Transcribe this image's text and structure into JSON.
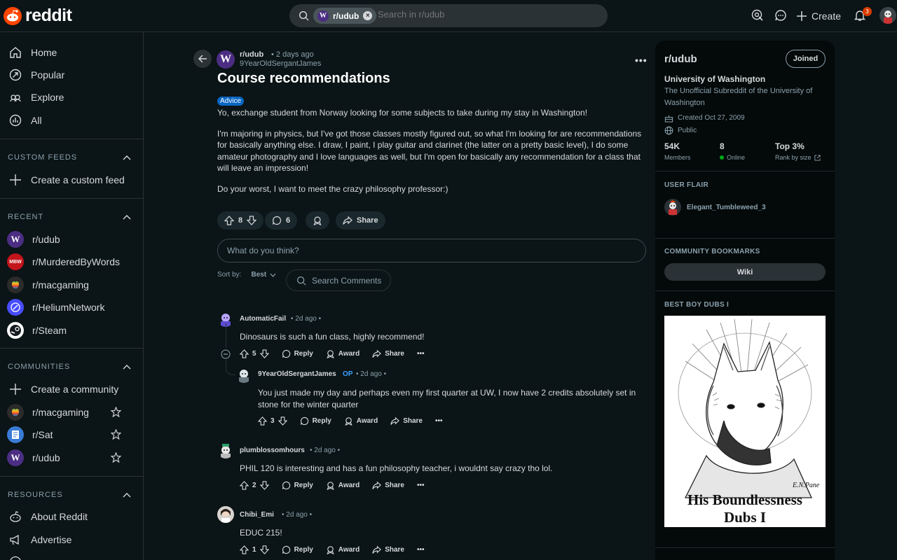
{
  "header": {
    "logo_text": "reddit",
    "search_chip": "r/udub",
    "search_placeholder": "Search in r/udub",
    "create_label": "Create",
    "notification_count": "3"
  },
  "sidebar": {
    "nav": [
      {
        "label": "Home",
        "icon": "home-icon"
      },
      {
        "label": "Popular",
        "icon": "popular-icon"
      },
      {
        "label": "Explore",
        "icon": "explore-icon"
      },
      {
        "label": "All",
        "icon": "all-icon"
      }
    ],
    "custom_feeds_heading": "CUSTOM FEEDS",
    "create_custom_feed": "Create a custom feed",
    "recent_heading": "RECENT",
    "recent": [
      "r/udub",
      "r/MurderedByWords",
      "r/macgaming",
      "r/HeliumNetwork",
      "r/Steam"
    ],
    "communities_heading": "COMMUNITIES",
    "create_community": "Create a community",
    "communities": [
      "r/macgaming",
      "r/Sat",
      "r/udub"
    ],
    "resources_heading": "RESOURCES",
    "resources": [
      "About Reddit",
      "Advertise"
    ]
  },
  "post": {
    "subreddit": "r/udub",
    "time": "• 2 days ago",
    "author": "9YearOldSergantJames",
    "title": "Course recommendations",
    "flair": "Advice",
    "body": [
      "Yo, exchange student from Norway looking for some subjects to take during my stay in Washington!",
      "I'm majoring in physics, but I've got those classes mostly figured out, so what I'm looking for are recommendations for basically anything else. I draw, I paint, I play guitar and clarinet (the latter on a pretty basic level), I do some amateur photography and I love languages as well, but I'm open for basically any recommendation for a class that will leave an impression!",
      "Do your worst, I want to meet the crazy philosophy professor:)"
    ],
    "votes": "8",
    "comments": "6",
    "share_label": "Share",
    "comment_placeholder": "What do you think?",
    "sort_label": "Sort by:",
    "sort_value": "Best",
    "search_comments": "Search Comments"
  },
  "comments": [
    {
      "user": "AutomaticFail",
      "time": "• 2d ago •",
      "text": "Dinosaurs is such a fun class, highly recommend!",
      "votes": "5"
    },
    {
      "user": "9YearOldSergantJames",
      "op": "OP",
      "time": "• 2d ago •",
      "text": "You just made my day and perhaps even my first quarter at UW, I now have 2 credits absolutely set in stone for the winter quarter",
      "votes": "3"
    },
    {
      "user": "plumblossomhours",
      "time": "• 2d ago •",
      "text": "PHIL 120 is interesting and has a fun philosophy teacher, i wouldnt say crazy tho lol.",
      "votes": "2"
    },
    {
      "user": "Chibi_Emi",
      "time": "• 2d ago •",
      "text": "EDUC 215!",
      "votes": "1"
    }
  ],
  "actions": {
    "reply": "Reply",
    "award": "Award",
    "share": "Share"
  },
  "right": {
    "title": "r/udub",
    "joined": "Joined",
    "name": "University of Washington",
    "description": "The Unofficial Subreddit of the University of Washington",
    "created": "Created Oct 27, 2009",
    "visibility": "Public",
    "members_value": "54K",
    "members_label": "Members",
    "online_value": "8",
    "online_label": "Online",
    "rank_value": "Top 3%",
    "rank_label": "Rank by size",
    "user_flair_heading": "USER FLAIR",
    "user_flair": "Elegant_Tumbleweed_3",
    "bookmarks_heading": "COMMUNITY BOOKMARKS",
    "wiki": "Wiki",
    "image_heading": "BEST BOY DUBS I",
    "image_caption_1": "His Boundlessness",
    "image_caption_2": "Dubs I",
    "image_signature": "E.N.Pane"
  },
  "colors": {
    "accent": "#ff4500",
    "udub_purple": "#4b2e83",
    "flair_blue": "#0a66c2",
    "bg": "#0b1416"
  }
}
